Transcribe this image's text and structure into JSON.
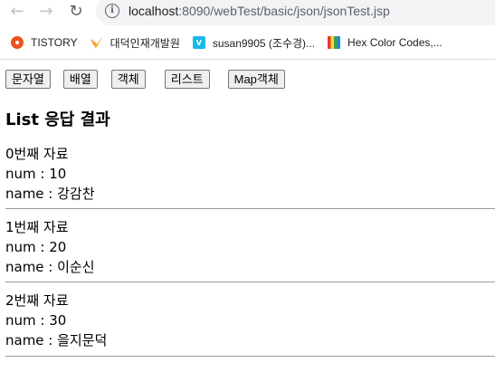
{
  "browser": {
    "back_icon": "arrow-left-icon",
    "forward_icon": "arrow-right-icon",
    "reload_icon": "reload-icon",
    "url_host": "localhost",
    "url_rest": ":8090/webTest/basic/json/jsonTest.jsp"
  },
  "bookmarks": [
    {
      "label": "TISTORY",
      "icon": "tistory-icon"
    },
    {
      "label": "대덕인재개발원",
      "icon": "daedeok-icon"
    },
    {
      "label": "susan9905 (조수경)...",
      "icon": "v-icon"
    },
    {
      "label": "Hex Color Codes,...",
      "icon": "hex-color-icon"
    }
  ],
  "buttons": {
    "string": "문자열",
    "array": "배열",
    "object": "객체",
    "list": "리스트",
    "map": "Map객체"
  },
  "heading": "List 응답 결과",
  "items": [
    {
      "title": "0번째 자료",
      "num": "num : 10",
      "name": "name : 강감찬"
    },
    {
      "title": "1번째 자료",
      "num": "num : 20",
      "name": "name : 이순신"
    },
    {
      "title": "2번째 자료",
      "num": "num : 30",
      "name": "name : 을지문덕"
    }
  ]
}
